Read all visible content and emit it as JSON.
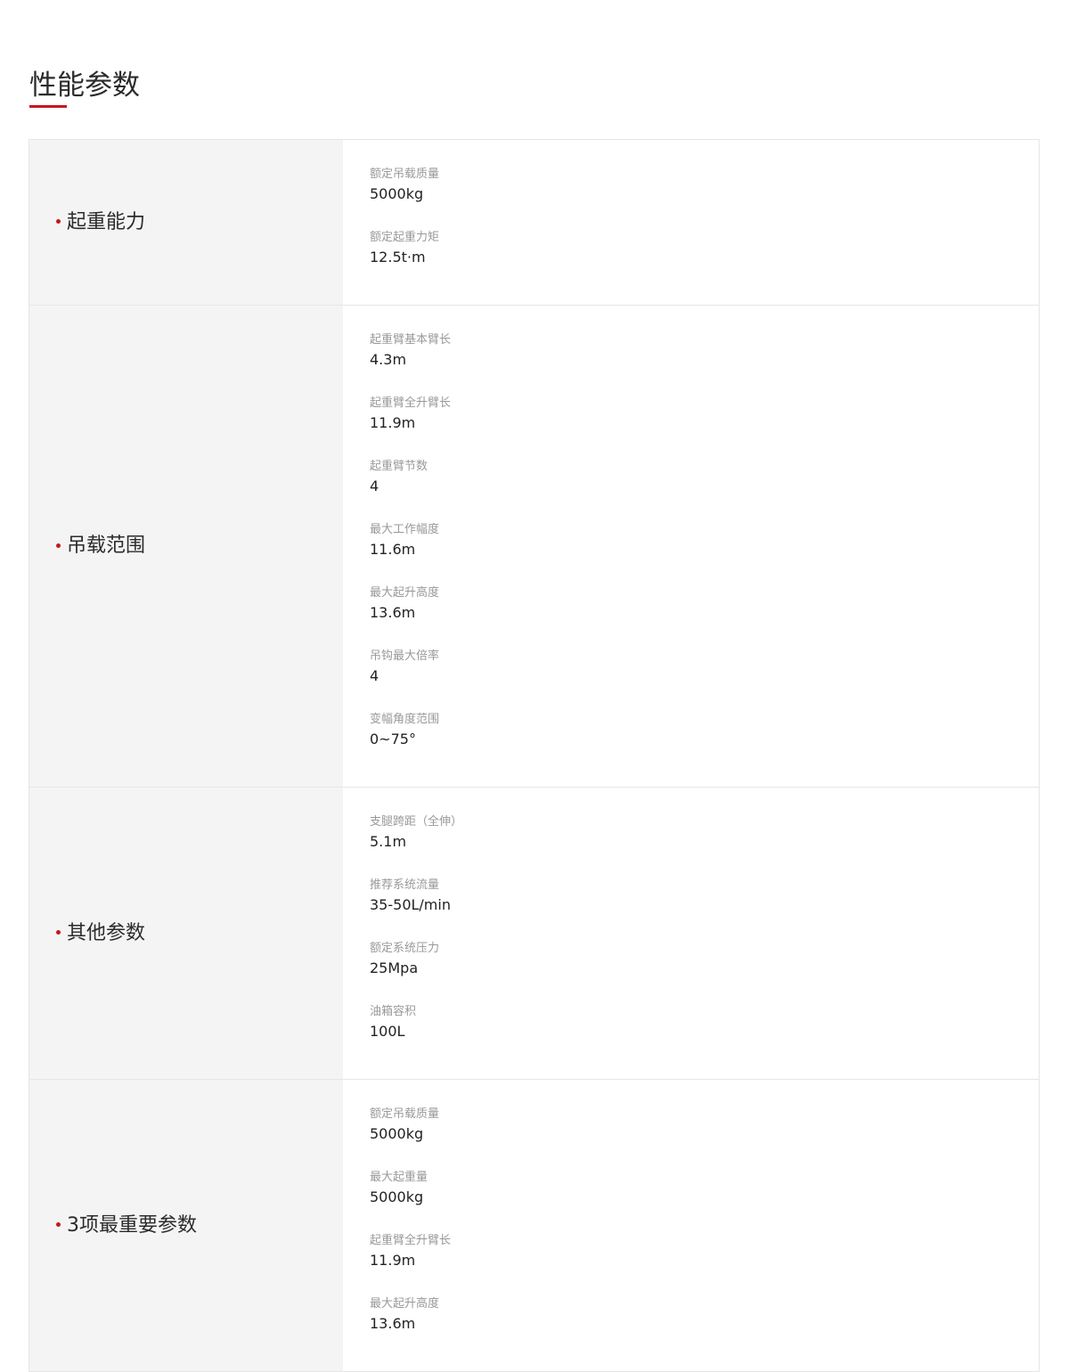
{
  "page": {
    "title": "性能参数"
  },
  "colors": {
    "accent": "#c8161d",
    "label_bg": "#f4f4f4",
    "border": "#e6e6e6",
    "param_label": "#999999"
  },
  "sections": [
    {
      "label": "起重能力",
      "params": [
        {
          "label": "额定吊载质量",
          "value": "5000kg"
        },
        {
          "label": "额定起重力矩",
          "value": "12.5t·m"
        }
      ]
    },
    {
      "label": "吊载范围",
      "params": [
        {
          "label": "起重臂基本臂长",
          "value": "4.3m"
        },
        {
          "label": "起重臂全升臂长",
          "value": "11.9m"
        },
        {
          "label": "起重臂节数",
          "value": "4"
        },
        {
          "label": "最大工作幅度",
          "value": "11.6m"
        },
        {
          "label": "最大起升高度",
          "value": "13.6m"
        },
        {
          "label": "吊钩最大倍率",
          "value": "4"
        },
        {
          "label": "变幅角度范围",
          "value": "0~75°"
        }
      ]
    },
    {
      "label": "其他参数",
      "params": [
        {
          "label": "支腿跨距（全伸）",
          "value": "5.1m"
        },
        {
          "label": "推荐系统流量",
          "value": "35-50L/min"
        },
        {
          "label": "额定系统压力",
          "value": "25Mpa"
        },
        {
          "label": "油箱容积",
          "value": "100L"
        }
      ]
    },
    {
      "label": "3项最重要参数",
      "params": [
        {
          "label": "额定吊载质量",
          "value": "5000kg"
        },
        {
          "label": "最大起重量",
          "value": "5000kg"
        },
        {
          "label": "起重臂全升臂长",
          "value": "11.9m"
        },
        {
          "label": "最大起升高度",
          "value": "13.6m"
        }
      ]
    }
  ]
}
